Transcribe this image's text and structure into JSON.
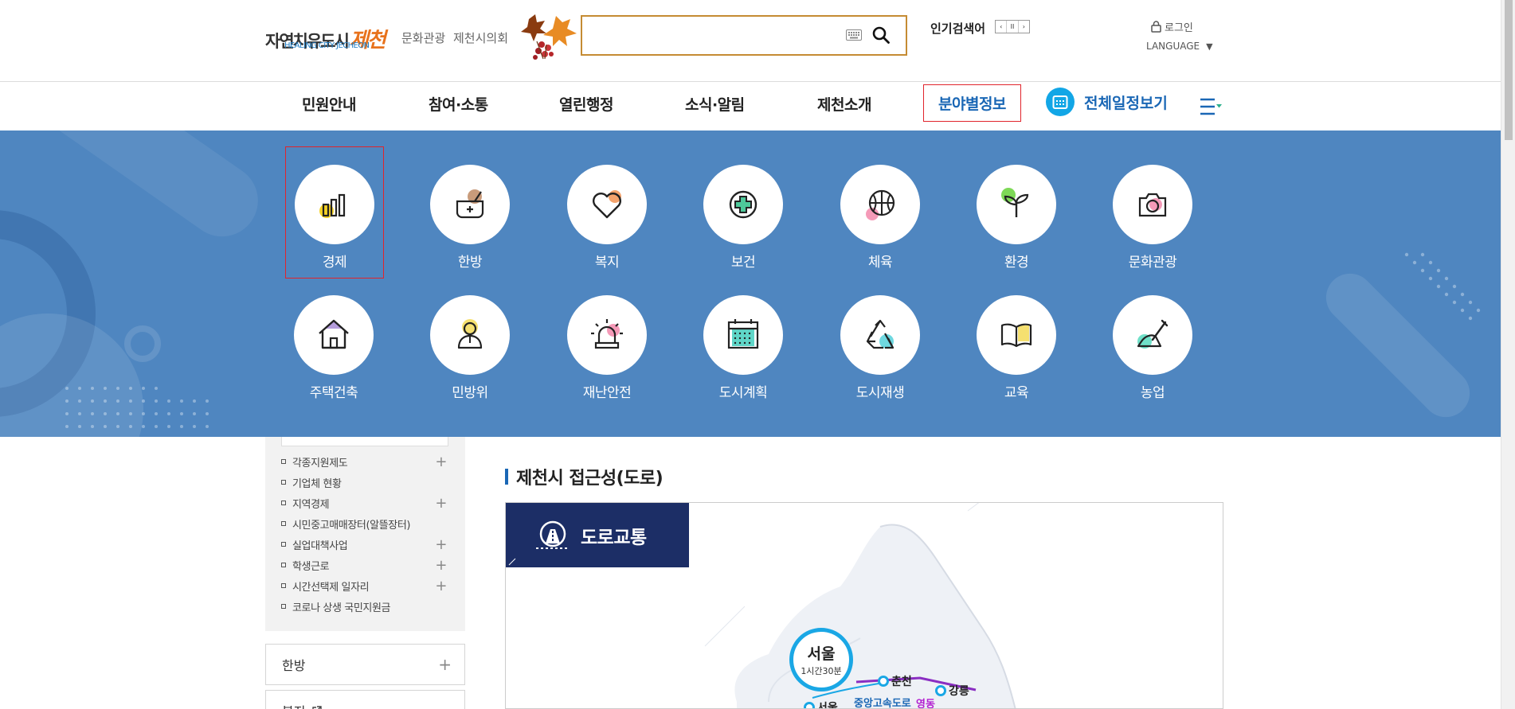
{
  "header": {
    "logo_text": "자연치유도시",
    "logo_city": "제천",
    "logo_sub": "HEALING CITY JECHEON",
    "links": [
      "문화관광",
      "제천시의회"
    ],
    "search": {
      "placeholder": "",
      "value": ""
    },
    "popular_label": "인기검색어",
    "roll_buttons": [
      "‹",
      "II",
      "›"
    ],
    "login": "로그인",
    "language": "LANGUAGE"
  },
  "nav": {
    "items": [
      "민원안내",
      "참여·소통",
      "열린행정",
      "소식·알림",
      "제천소개",
      "분야별정보"
    ],
    "active": "분야별정보",
    "calendar": "전체일정보기"
  },
  "categories": [
    {
      "label": "경제",
      "icon": "economy-chart-icon",
      "accent": "#f5d328"
    },
    {
      "label": "한방",
      "icon": "herbal-medicine-icon",
      "accent": "#c89b7b"
    },
    {
      "label": "복지",
      "icon": "heart-icon",
      "accent": "#f4a36c"
    },
    {
      "label": "보건",
      "icon": "health-cross-icon",
      "accent": "#4ec99a"
    },
    {
      "label": "체육",
      "icon": "basketball-icon",
      "accent": "#f59ab8"
    },
    {
      "label": "환경",
      "icon": "sprout-icon",
      "accent": "#7ed957"
    },
    {
      "label": "문화관광",
      "icon": "camera-icon",
      "accent": "#f59ab8"
    },
    {
      "label": "주택건축",
      "icon": "house-icon",
      "accent": "#b59ddc"
    },
    {
      "label": "민방위",
      "icon": "civil-defense-person-icon",
      "accent": "#f5e070"
    },
    {
      "label": "재난안전",
      "icon": "siren-icon",
      "accent": "#f59ab8"
    },
    {
      "label": "도시계획",
      "icon": "calendar-grid-icon",
      "accent": "#5fd6c8"
    },
    {
      "label": "도시재생",
      "icon": "recycle-icon",
      "accent": "#6fd8e0"
    },
    {
      "label": "교육",
      "icon": "book-icon",
      "accent": "#f5e070"
    },
    {
      "label": "농업",
      "icon": "farm-shovel-icon",
      "accent": "#6fe0c8"
    }
  ],
  "selected_category": "경제",
  "sidebar": {
    "items": [
      {
        "label": "각종지원제도",
        "plus": true
      },
      {
        "label": "기업체 현황",
        "plus": false
      },
      {
        "label": "지역경제",
        "plus": true
      },
      {
        "label": "시민중고매매장터(알뜰장터)",
        "plus": false
      },
      {
        "label": "실업대책사업",
        "plus": true
      },
      {
        "label": "학생근로",
        "plus": true
      },
      {
        "label": "시간선택제 일자리",
        "plus": true
      },
      {
        "label": "코로나 상생 국민지원금",
        "plus": false
      }
    ],
    "categories": [
      {
        "label": "한방",
        "marker": "+"
      },
      {
        "label": "복지",
        "marker": "external"
      }
    ]
  },
  "content": {
    "title": "제천시 접근성(도로)",
    "badge": "도로교통",
    "seoul": {
      "name": "서울",
      "time": "1시간30분"
    },
    "cities": [
      "춘천",
      "강릉",
      "서울"
    ],
    "roads": [
      "중앙고속도로",
      "영동"
    ]
  },
  "colors": {
    "nav_blue": "#1a67b5",
    "mega_bg": "#4f86c0",
    "search_border": "#c58b33",
    "badge_bg": "#1c2e66",
    "highlight_red": "#e1242c"
  }
}
